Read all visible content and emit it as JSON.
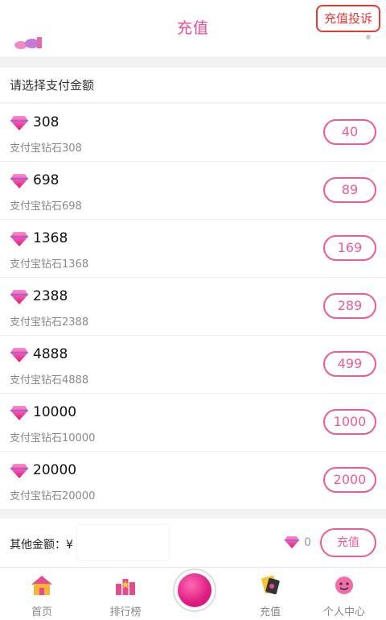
{
  "header": {
    "title": "充值",
    "complain_label": "充值投诉"
  },
  "section_title": "请选择支付金额",
  "packages": [
    {
      "amount": "308",
      "desc": "支付宝钻石308",
      "price": "40"
    },
    {
      "amount": "698",
      "desc": "支付宝钻石698",
      "price": "89"
    },
    {
      "amount": "1368",
      "desc": "支付宝钻石1368",
      "price": "169"
    },
    {
      "amount": "2388",
      "desc": "支付宝钻石2388",
      "price": "289"
    },
    {
      "amount": "4888",
      "desc": "支付宝钻石4888",
      "price": "499"
    },
    {
      "amount": "10000",
      "desc": "支付宝钻石10000",
      "price": "1000"
    },
    {
      "amount": "20000",
      "desc": "支付宝钻石20000",
      "price": "2000"
    }
  ],
  "other": {
    "label": "其他金额：¥",
    "input_value": "",
    "diamond_count": "0",
    "recharge_label": "充值"
  },
  "tabs": [
    {
      "label": "首页",
      "icon": "home-icon"
    },
    {
      "label": "排行榜",
      "icon": "ranking-icon"
    },
    {
      "label": "",
      "icon": "center-ball-icon"
    },
    {
      "label": "充值",
      "icon": "recharge-icon"
    },
    {
      "label": "个人中心",
      "icon": "profile-icon"
    }
  ],
  "colors": {
    "accent": "#ea5b9a",
    "title": "#f0478f",
    "complain": "#e53935"
  }
}
